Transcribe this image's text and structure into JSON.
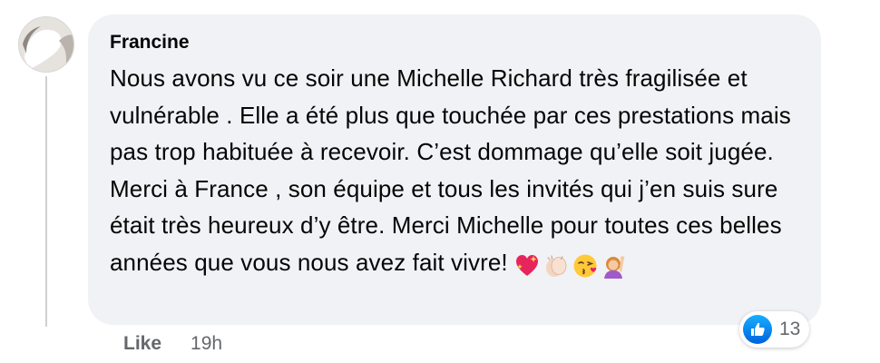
{
  "comment": {
    "author": "Francine",
    "text": "Nous avons vu ce soir une Michelle Richard très fragilisée et vulnérable . Elle a été plus que touchée par ces prestations mais pas trop habituée à recevoir. C’est dommage qu’elle soit jugée. Merci à France , son équipe et tous les invités qui j’en suis sure était très heureux d’y être. Merci Michelle pour toutes ces belles années que vous nous avez fait vivre!",
    "emojis": [
      "sparkling-heart-icon",
      "clapping-hands-icon",
      "face-blowing-kiss-icon",
      "person-raising-hand-icon"
    ]
  },
  "reactions": {
    "icon": "like-thumb-icon",
    "count": "13",
    "color": "#1877F2"
  },
  "actions": {
    "like_label": "Like",
    "timestamp": "19h"
  },
  "colors": {
    "bubble": "#f0f2f5",
    "secondary_text": "#65676b",
    "thread_line": "#ced0d4"
  }
}
